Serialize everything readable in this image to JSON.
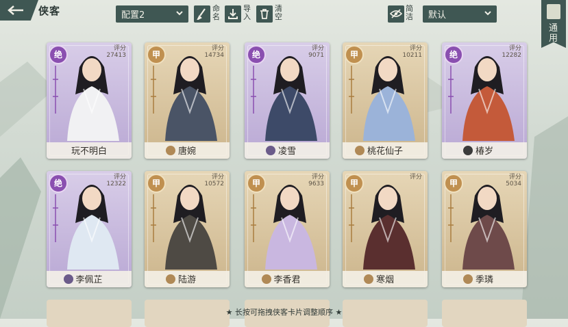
{
  "header": {
    "back_label": "返回",
    "title": "侠客",
    "preset_select": "配置2",
    "rename_label": "命名",
    "import_label": "导入",
    "clear_label": "清空",
    "simple_label": "简洁",
    "sort_select": "默认",
    "general_label": "通用"
  },
  "score_label": "评分",
  "cards": [
    {
      "name": "玩不明白",
      "score": "27413",
      "badge": "绝",
      "rarity": "jue",
      "sect_icon": ""
    },
    {
      "name": "唐婉",
      "score": "14734",
      "badge": "甲",
      "rarity": "jia",
      "sect_icon": "sect-icon"
    },
    {
      "name": "凌雪",
      "score": "9071",
      "badge": "绝",
      "rarity": "jue",
      "sect_icon": "blade-icon"
    },
    {
      "name": "桃花仙子",
      "score": "10211",
      "badge": "甲",
      "rarity": "jia",
      "sect_icon": "sect-icon"
    },
    {
      "name": "椿岁",
      "score": "12282",
      "badge": "绝",
      "rarity": "jue",
      "sect_icon": "swirl-icon"
    },
    {
      "name": "李佩芷",
      "score": "12322",
      "badge": "绝",
      "rarity": "jue",
      "sect_icon": "blade-icon"
    },
    {
      "name": "陆游",
      "score": "10572",
      "badge": "甲",
      "rarity": "jia",
      "sect_icon": "sect-icon"
    },
    {
      "name": "李香君",
      "score": "9633",
      "badge": "甲",
      "rarity": "jia",
      "sect_icon": "sect-icon"
    },
    {
      "name": "寒烟",
      "score": "",
      "badge": "甲",
      "rarity": "jia",
      "sect_icon": "sect-icon"
    },
    {
      "name": "季璘",
      "score": "5034",
      "badge": "甲",
      "rarity": "jia",
      "sect_icon": "sect-icon"
    }
  ],
  "footer": {
    "hint": "★ 长按可拖拽侠客卡片调整顺序 ★"
  },
  "colors": {
    "dark_teal": "#3f5753",
    "jue_purple": "#8a4fb0",
    "jia_gold": "#c09050"
  }
}
